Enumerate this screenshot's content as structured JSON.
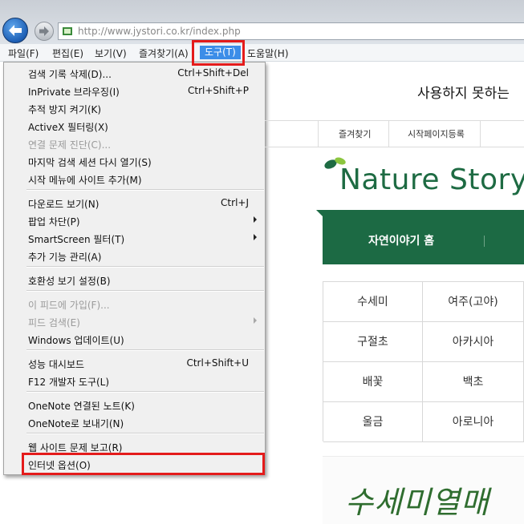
{
  "browser": {
    "url": "http://www.jystori.co.kr/index.php"
  },
  "menubar": {
    "items": [
      "파일(F)",
      "편집(E)",
      "보기(V)",
      "즐겨찾기(A)",
      "도구(T)",
      "도움말(H)"
    ],
    "active_index": 4
  },
  "tools_menu": {
    "items": [
      {
        "label": "검색 기록 삭제(D)...",
        "shortcut": "Ctrl+Shift+Del"
      },
      {
        "label": "InPrivate 브라우징(I)",
        "shortcut": "Ctrl+Shift+P"
      },
      {
        "label": "추적 방지 켜기(K)"
      },
      {
        "label": "ActiveX 필터링(X)"
      },
      {
        "label": "연결 문제 진단(C)...",
        "disabled": true
      },
      {
        "label": "마지막 검색 세션 다시 열기(S)"
      },
      {
        "label": "시작 메뉴에 사이트 추가(M)"
      },
      {
        "label": "다운로드 보기(N)",
        "shortcut": "Ctrl+J"
      },
      {
        "label": "팝업 차단(P)",
        "submenu": true
      },
      {
        "label": "SmartScreen 필터(T)",
        "submenu": true
      },
      {
        "label": "추가 기능 관리(A)"
      },
      {
        "label": "호환성 보기 설정(B)"
      },
      {
        "label": "이 피드에 가입(F)...",
        "disabled": true
      },
      {
        "label": "피드 검색(E)",
        "disabled": true,
        "submenu": true
      },
      {
        "label": "Windows 업데이트(U)"
      },
      {
        "label": "성능 대시보드",
        "shortcut": "Ctrl+Shift+U"
      },
      {
        "label": "F12 개발자 도구(L)"
      },
      {
        "label": "OneNote 연결된 노트(K)"
      },
      {
        "label": "OneNote로 보내기(N)"
      },
      {
        "label": "웹 사이트 문제 보고(R)"
      },
      {
        "label": "인터넷 옵션(O)",
        "highlighted": true
      }
    ]
  },
  "page": {
    "headline": "사용하지 못하는 ",
    "quick_links": [
      "즐겨찾기",
      "시작페이지등록"
    ],
    "logo_text": "Nature Story",
    "nav_home": "자연이야기 홈",
    "grid": [
      [
        "수세미",
        "여주(고야)"
      ],
      [
        "구절초",
        "아카시아"
      ],
      [
        "배꽃",
        "백초"
      ],
      [
        "울금",
        "아로니아"
      ]
    ],
    "banner_text": "수세미열매"
  },
  "colors": {
    "brand_green": "#1c6a44",
    "highlight_red": "#e41b1b",
    "menu_active_blue": "#3c8de8"
  }
}
